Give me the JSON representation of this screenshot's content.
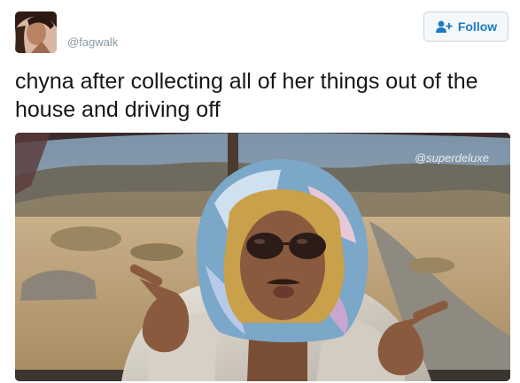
{
  "header": {
    "handle": "@fagwalk",
    "follow_label": "Follow"
  },
  "tweet": {
    "text": "chyna after collecting all of her things out of the house and driving off"
  },
  "media": {
    "watermark": "@superdeluxe"
  },
  "colors": {
    "accent": "#1b7bc2",
    "text": "#14171a",
    "muted": "#8899a6"
  },
  "icons": {
    "follow": "person-plus-icon"
  }
}
